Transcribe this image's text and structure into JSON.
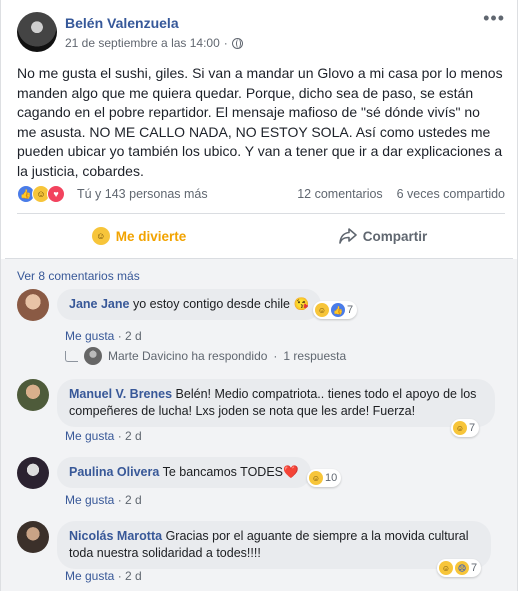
{
  "post": {
    "author": "Belén Valenzuela",
    "timestamp": "21 de septiembre a las 14:00",
    "privacy_icon": "globe-icon",
    "text": "No me gusta el sushi, giles. Si van a mandar un Glovo a mi casa por lo menos manden algo que me quiera quedar. Porque, dicho sea de paso, se están cagando en el pobre repartidor. El mensaje mafioso de \"sé dónde vivís\" no me asusta. NO ME CALLO NADA, NO ESTOY SOLA. Así como ustedes me pueden ubicar yo también los ubico. Y van a tener que ir a dar explicaciones a la justicia, cobardes.",
    "reactions_summary": "Tú y 143 personas más",
    "comments_count": "12 comentarios",
    "shares_count": "6 veces compartido"
  },
  "actions": {
    "react_label": "Me divierte",
    "share_label": "Compartir"
  },
  "comments_section": {
    "view_more": "Ver 8 comentarios más",
    "comments": [
      {
        "name": "Jane Jane",
        "text": "yo estoy contigo desde chile 😘",
        "like_label": "Me gusta",
        "age": "2 d",
        "reaction_count": "7"
      },
      {
        "name": "Manuel V. Brenes",
        "text": "Belén! Medio compatriota.. tienes todo el apoyo de los compeñeres de lucha! Lxs joden se nota que les arde! Fuerza!",
        "like_label": "Me gusta",
        "age": "2 d",
        "reaction_count": "7"
      },
      {
        "name": "Paulina Olivera",
        "text": "Te bancamos TODES❤️",
        "like_label": "Me gusta",
        "age": "2 d",
        "reaction_count": "10"
      },
      {
        "name": "Nicolás Marotta",
        "text": "Gracias por el aguante de siempre a la movida cultural toda nuestra solidaridad a todes!!!!",
        "like_label": "Me gusta",
        "age": "2 d",
        "reaction_count": "7"
      }
    ],
    "reply": {
      "text": "Marte Davicino ha respondido",
      "count": "1 respuesta"
    }
  },
  "colors": {
    "link": "#385898",
    "author": "#365899",
    "active_reaction": "#f2a300",
    "comment_bubble": "#e9ebee"
  }
}
